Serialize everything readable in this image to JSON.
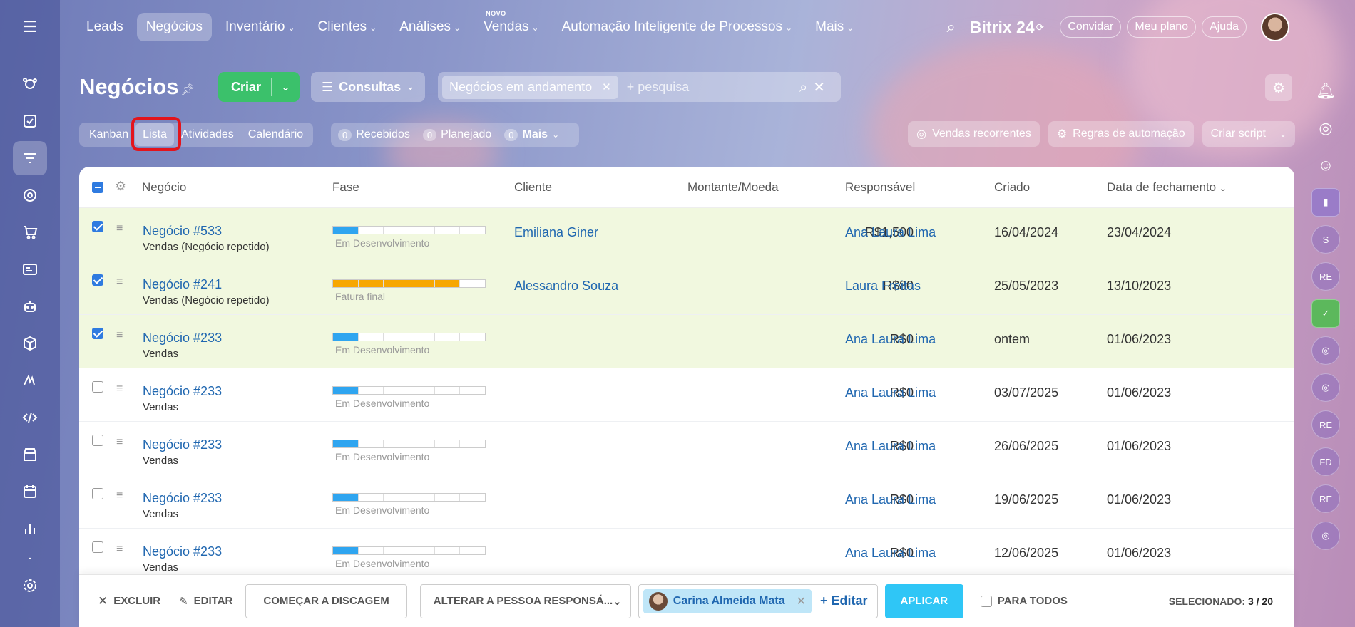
{
  "topnav": {
    "items": [
      {
        "label": "Leads",
        "chevron": false,
        "active": false
      },
      {
        "label": "Negócios",
        "chevron": false,
        "active": true
      },
      {
        "label": "Inventário",
        "chevron": true,
        "active": false
      },
      {
        "label": "Clientes",
        "chevron": true,
        "active": false
      },
      {
        "label": "Análises",
        "chevron": true,
        "active": false
      },
      {
        "label": "Vendas",
        "chevron": true,
        "active": false,
        "badge": "NOVO"
      },
      {
        "label": "Automação Inteligente de Processos",
        "chevron": true,
        "active": false
      },
      {
        "label": "Mais",
        "chevron": true,
        "active": false
      }
    ],
    "brand": "Bitrix 24",
    "invite": "Convidar",
    "plan": "Meu plano",
    "help": "Ajuda"
  },
  "header": {
    "title": "Negócios",
    "create_label": "Criar",
    "queries_label": "Consultas",
    "filter_chip": "Negócios em andamento",
    "search_placeholder": "+ pesquisa"
  },
  "views": {
    "tabs": [
      "Kanban",
      "Lista",
      "Atividades",
      "Calendário"
    ],
    "active": "Lista"
  },
  "counters": [
    {
      "count": "0",
      "label": "Recebidos"
    },
    {
      "count": "0",
      "label": "Planejado"
    },
    {
      "count": "0",
      "label": "Mais"
    }
  ],
  "actions": {
    "recurring": "Vendas recorrentes",
    "automation": "Regras de automação",
    "script": "Criar script"
  },
  "table": {
    "columns": [
      "Negócio",
      "Fase",
      "Cliente",
      "Montante/Moeda",
      "Responsável",
      "Criado",
      "Data de fechamento"
    ],
    "rows": [
      {
        "name": "Negócio #533",
        "sub": "Vendas (Negócio repetido)",
        "stage": "Em Desenvolvimento",
        "stage_progress": 1,
        "client": "Emiliana Giner",
        "amount": "R$1,500",
        "resp": "Ana Laura Lima",
        "created": "16/04/2024",
        "closing": "23/04/2024",
        "selected": true
      },
      {
        "name": "Negócio #241",
        "sub": "Vendas (Negócio repetido)",
        "stage": "Fatura final",
        "stage_progress": 5,
        "client": "Alessandro Souza",
        "amount": "R$80",
        "resp": "Laura Freitas",
        "created": "25/05/2023",
        "closing": "13/10/2023",
        "selected": true
      },
      {
        "name": "Negócio #233",
        "sub": "Vendas",
        "stage": "Em Desenvolvimento",
        "stage_progress": 1,
        "client": "",
        "amount": "R$0",
        "resp": "Ana Laura Lima",
        "created": "ontem",
        "closing": "01/06/2023",
        "selected": true
      },
      {
        "name": "Negócio #233",
        "sub": "Vendas",
        "stage": "Em Desenvolvimento",
        "stage_progress": 1,
        "client": "",
        "amount": "R$0",
        "resp": "Ana Laura Lima",
        "created": "03/07/2025",
        "closing": "01/06/2023",
        "selected": false
      },
      {
        "name": "Negócio #233",
        "sub": "Vendas",
        "stage": "Em Desenvolvimento",
        "stage_progress": 1,
        "client": "",
        "amount": "R$0",
        "resp": "Ana Laura Lima",
        "created": "26/06/2025",
        "closing": "01/06/2023",
        "selected": false
      },
      {
        "name": "Negócio #233",
        "sub": "Vendas",
        "stage": "Em Desenvolvimento",
        "stage_progress": 1,
        "client": "",
        "amount": "R$0",
        "resp": "Ana Laura Lima",
        "created": "19/06/2025",
        "closing": "01/06/2023",
        "selected": false
      },
      {
        "name": "Negócio #233",
        "sub": "Vendas",
        "stage": "Em Desenvolvimento",
        "stage_progress": 1,
        "client": "",
        "amount": "R$0",
        "resp": "Ana Laura Lima",
        "created": "12/06/2025",
        "closing": "01/06/2023",
        "selected": false
      }
    ]
  },
  "footer": {
    "delete": "Excluir",
    "edit": "Editar",
    "dial": "Começar a discagem",
    "change_resp": "Alterar a pessoa responsá...",
    "person": "Carina Almeida Mata",
    "person_edit": "+ Editar",
    "apply": "Aplicar",
    "for_all": "Para todos",
    "selected_label": "Selecionado:",
    "selected_value": "3 / 20"
  },
  "rightbar": [
    "S",
    "RE",
    "RE",
    "FD",
    "RE"
  ],
  "colors": {
    "accent": "#2067b0",
    "create": "#3bc16b",
    "apply": "#2fc6f6",
    "stage_blue": "#2fa5f0",
    "stage_orange": "#f7a700",
    "selected_row": "#f1f8df",
    "highlight": "#e3141c"
  }
}
